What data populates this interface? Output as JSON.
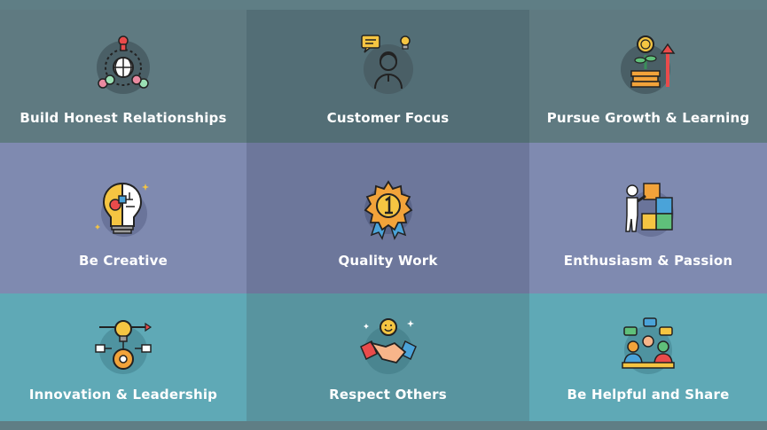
{
  "tiles": [
    {
      "label": "Build Honest Relationships",
      "icon": "network-globe-icon"
    },
    {
      "label": "Customer Focus",
      "icon": "customer-support-icon"
    },
    {
      "label": "Pursue Growth & Learning",
      "icon": "coin-growth-icon"
    },
    {
      "label": "Be Creative",
      "icon": "creative-bulb-icon"
    },
    {
      "label": "Quality Work",
      "icon": "award-badge-icon"
    },
    {
      "label": "Enthusiasm & Passion",
      "icon": "puzzle-person-icon"
    },
    {
      "label": "Innovation & Leadership",
      "icon": "bulb-gear-icon"
    },
    {
      "label": "Respect Others",
      "icon": "handshake-icon"
    },
    {
      "label": "Be Helpful and Share",
      "icon": "team-chat-icon"
    }
  ],
  "colors": {
    "background": "#5f7e85",
    "row1": "#5f7a81",
    "row2": "#7f8ab0",
    "row3": "#5fa9b6",
    "text": "#ffffff"
  }
}
